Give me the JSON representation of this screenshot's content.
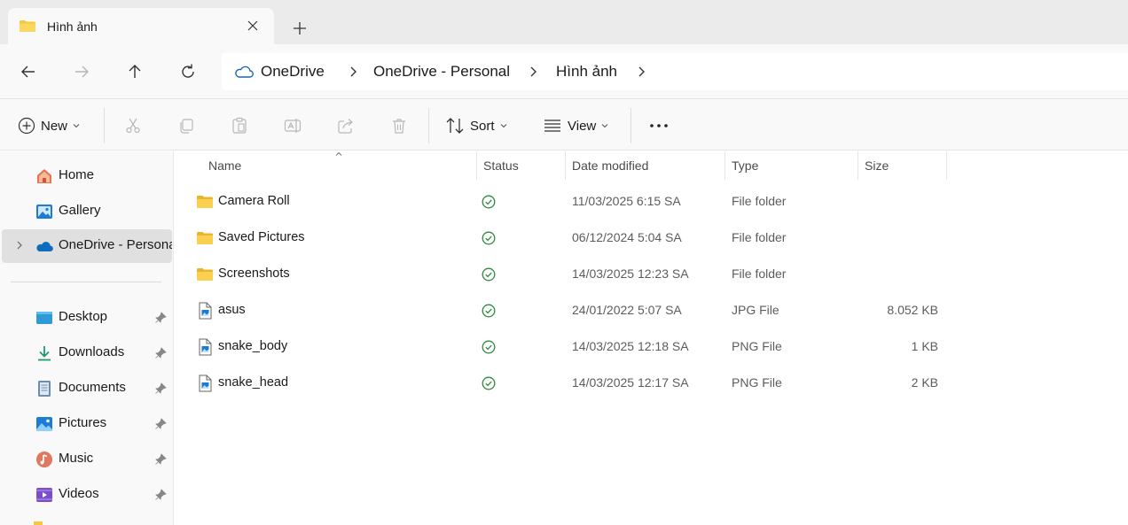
{
  "tab": {
    "title": "Hình ảnh"
  },
  "breadcrumb": [
    {
      "label": "OneDrive"
    },
    {
      "label": "OneDrive - Personal"
    },
    {
      "label": "Hình ảnh"
    }
  ],
  "toolbar": {
    "new_label": "New",
    "sort_label": "Sort",
    "view_label": "View"
  },
  "sidebar": {
    "items": [
      {
        "label": "Home",
        "icon": "home-icon"
      },
      {
        "label": "Gallery",
        "icon": "gallery-icon"
      },
      {
        "label": "OneDrive - Personal",
        "icon": "onedrive-cloud-icon"
      },
      {
        "label": "Desktop",
        "icon": "desktop-icon"
      },
      {
        "label": "Downloads",
        "icon": "downloads-icon"
      },
      {
        "label": "Documents",
        "icon": "documents-icon"
      },
      {
        "label": "Pictures",
        "icon": "pictures-icon"
      },
      {
        "label": "Music",
        "icon": "music-icon"
      },
      {
        "label": "Videos",
        "icon": "videos-icon"
      }
    ]
  },
  "columns": {
    "name": "Name",
    "status": "Status",
    "date": "Date modified",
    "type": "Type",
    "size": "Size"
  },
  "files": [
    {
      "name": "Camera Roll",
      "date": "11/03/2025 6:15 SA",
      "type": "File folder",
      "size": "",
      "icon": "folder-icon"
    },
    {
      "name": "Saved Pictures",
      "date": "06/12/2024 5:04 SA",
      "type": "File folder",
      "size": "",
      "icon": "folder-icon"
    },
    {
      "name": "Screenshots",
      "date": "14/03/2025 12:23 SA",
      "type": "File folder",
      "size": "",
      "icon": "folder-icon"
    },
    {
      "name": "asus",
      "date": "24/01/2022 5:07 SA",
      "type": "JPG File",
      "size": "8.052 KB",
      "icon": "image-file-icon"
    },
    {
      "name": "snake_body",
      "date": "14/03/2025 12:18 SA",
      "type": "PNG File",
      "size": "1 KB",
      "icon": "image-file-icon"
    },
    {
      "name": "snake_head",
      "date": "14/03/2025 12:17 SA",
      "type": "PNG File",
      "size": "2 KB",
      "icon": "image-file-icon"
    }
  ],
  "colors": {
    "accent": "#0067c0",
    "folder": "#f8c83c",
    "synced": "#2e8b3d"
  }
}
